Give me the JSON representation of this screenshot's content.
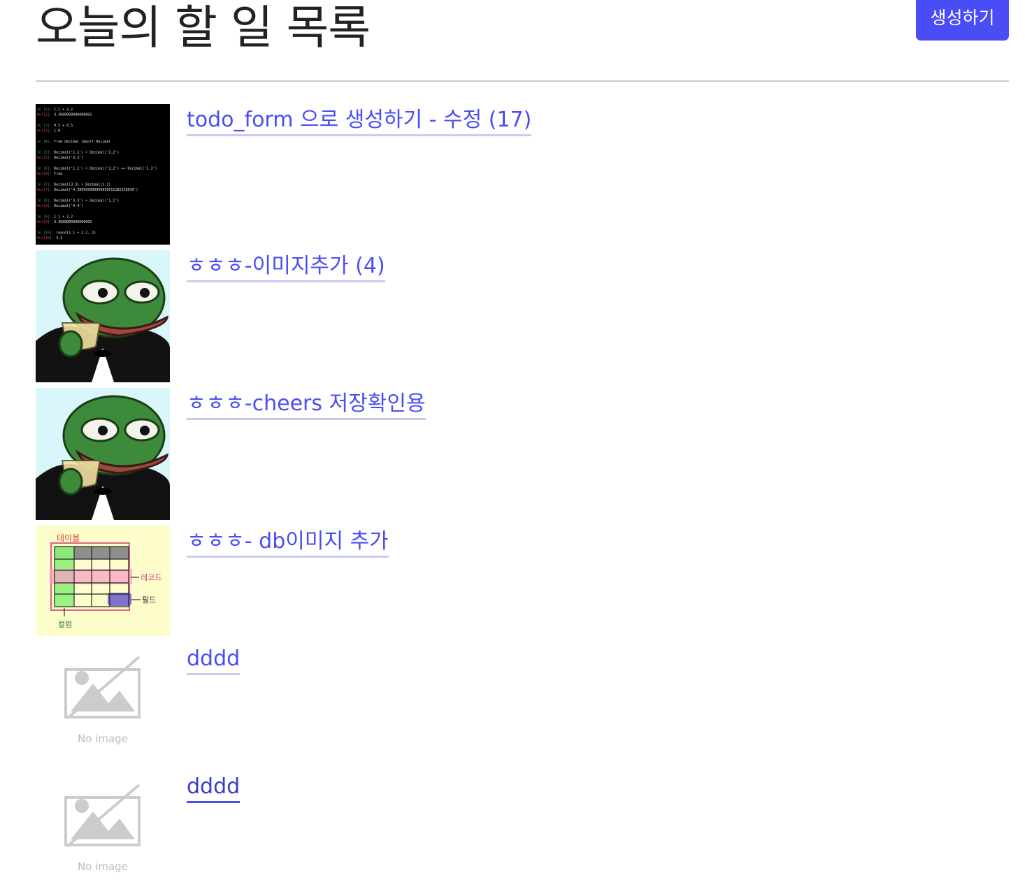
{
  "header": {
    "title": "오늘의 할 일 목록",
    "create_label": "생성하기"
  },
  "todos": [
    {
      "title": "todo_form 으로 생성하기 - 수정 (17)",
      "image": "code-screenshot"
    },
    {
      "title": "ㅎㅎㅎ-이미지추가 (4)",
      "image": "pepe-cheers"
    },
    {
      "title": "ㅎㅎㅎ-cheers 저장확인용",
      "image": "pepe-cheers"
    },
    {
      "title": "ㅎㅎㅎ- db이미지 추가",
      "image": "table-diagram"
    },
    {
      "title": "dddd",
      "image": "no-image"
    },
    {
      "title": "dddd",
      "image": "no-image"
    }
  ],
  "code_lines": [
    {
      "prompt": "In [2]:",
      "code": "1.1 + 2.2"
    },
    {
      "prompt": "Out[2]:",
      "code": "3.3000000000000003"
    },
    {
      "prompt": "In [3]:",
      "code": "0.5 + 0.5"
    },
    {
      "prompt": "Out[3]:",
      "code": "1.0"
    },
    {
      "prompt": "In [4]:",
      "code": "from decimal import Decimal"
    },
    {
      "prompt": "In [5]:",
      "code": "Decimal('1.1') + Decimal('2.2')"
    },
    {
      "prompt": "Out[5]:",
      "code": "Decimal('3.3')"
    },
    {
      "prompt": "In [6]:",
      "code": "Decimal('1.1') + Decimal('2.2') == Decimal('3.3')"
    },
    {
      "prompt": "Out[6]:",
      "code": "True"
    },
    {
      "prompt": "In [7]:",
      "code": "Decimal(3.3) + Decimal(1.1)"
    },
    {
      "prompt": "Out[7]:",
      "code": "Decimal('4.399999999999999911182158030')"
    },
    {
      "prompt": "In [8]:",
      "code": "Decimal('3.3') + Decimal('1.1')"
    },
    {
      "prompt": "Out[8]:",
      "code": "Decimal('4.4')"
    },
    {
      "prompt": "In [9]:",
      "code": "1.1 + 2.2"
    },
    {
      "prompt": "Out[9]:",
      "code": "3.3000000000000003"
    },
    {
      "prompt": "In [10]:",
      "code": "round(1.1 + 2.2, 2)"
    },
    {
      "prompt": "Out[10]:",
      "code": "3.3"
    }
  ],
  "diagram": {
    "table_label": "테이블",
    "record_label": "레코드",
    "field_label": "필드",
    "column_label": "컬럼"
  },
  "placeholder": {
    "no_image_text": "No image"
  },
  "colors": {
    "accent": "#4a4df5",
    "link_underline": "#c9cbf3",
    "title_text": "#222222",
    "divider": "#c8c8c8"
  }
}
